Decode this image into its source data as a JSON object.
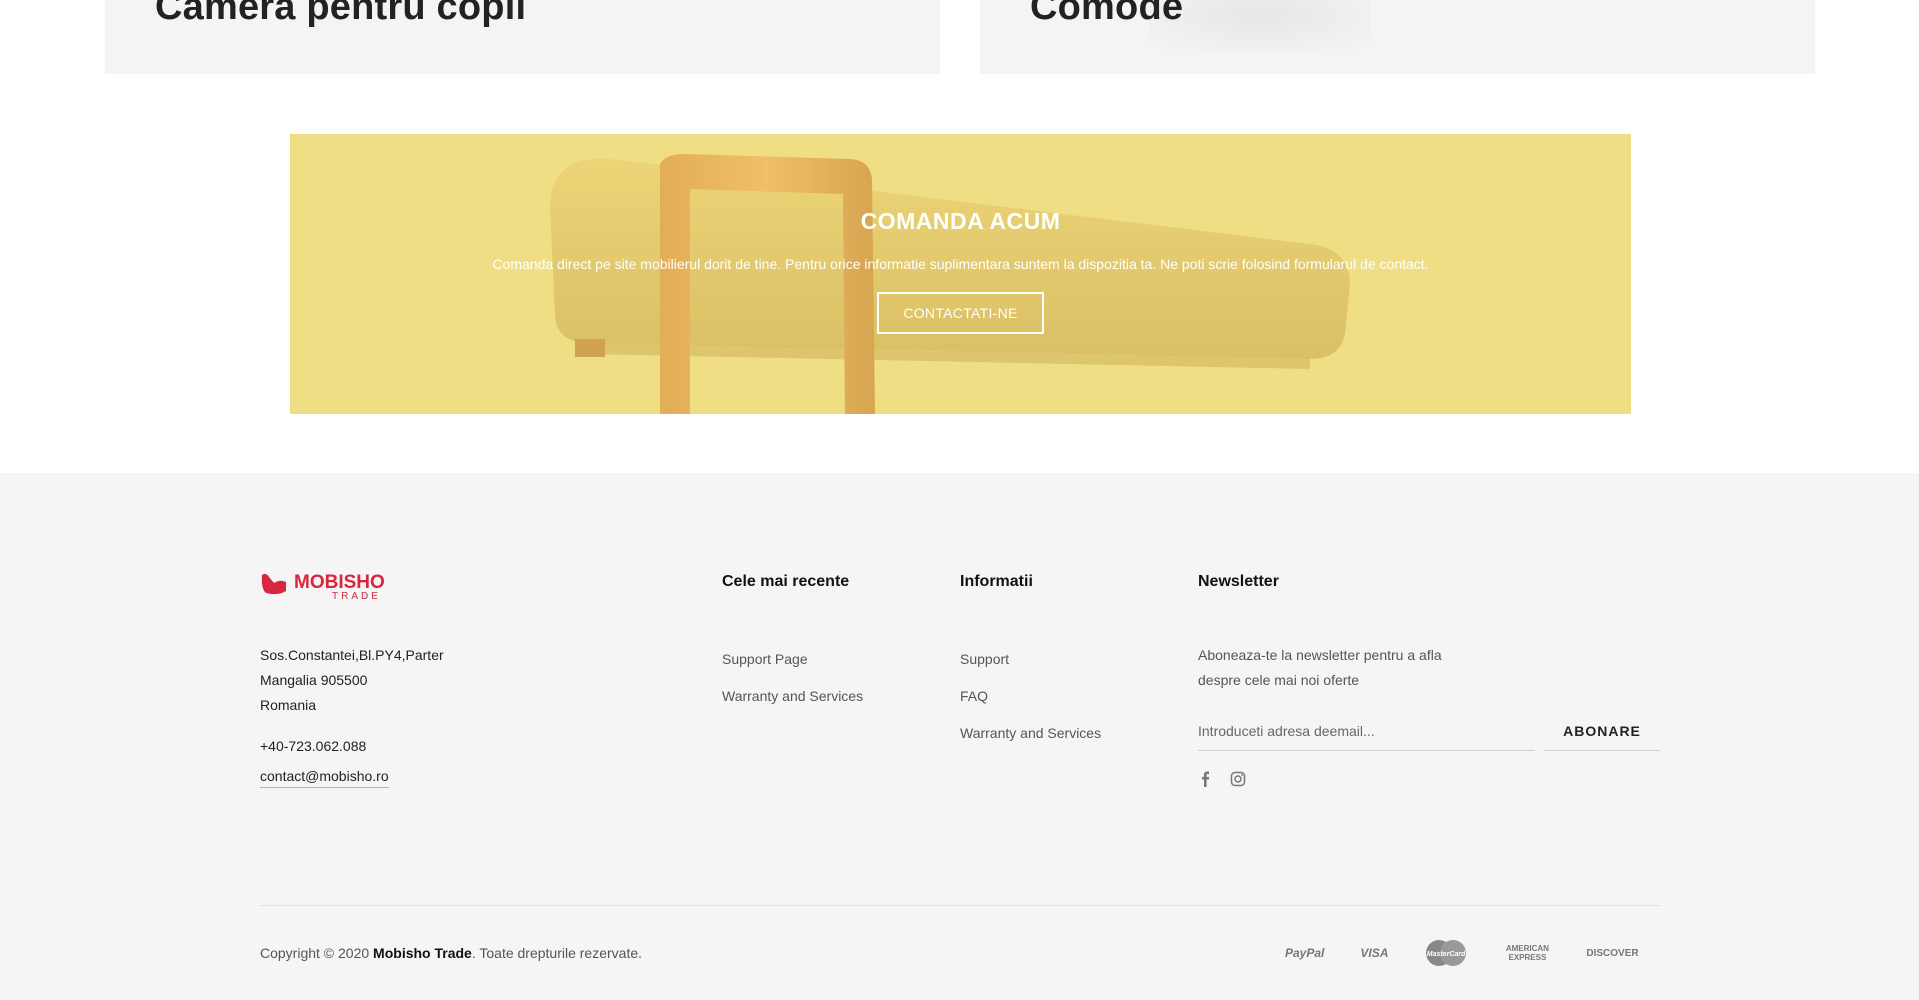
{
  "categories": [
    {
      "title": "Cameră pentru copii"
    },
    {
      "title": "Comode"
    }
  ],
  "banner": {
    "heading": "COMANDA ACUM",
    "text": "Comanda direct pe site mobilierul dorit de tine. Pentru orice informatie suplimentara suntem la dispozitia ta. Ne poti scrie folosind formularul de contact.",
    "button_label": "CONTACTATI-NE"
  },
  "footer": {
    "logo": {
      "name": "MOBISHO",
      "sub": "TRADE"
    },
    "address": [
      "Sos.Constantei,Bl.PY4,Parter",
      "Mangalia 905500",
      "Romania"
    ],
    "phone": "+40-723.062.088",
    "email": "contact@mobisho.ro",
    "recent": {
      "title": "Cele mai recente",
      "items": [
        "Support Page",
        "Warranty and Services"
      ]
    },
    "info": {
      "title": "Informatii",
      "items": [
        "Support",
        "FAQ",
        "Warranty and Services"
      ]
    },
    "newsletter": {
      "title": "Newsletter",
      "text": "Aboneaza-te la newsletter pentru a afla despre cele mai noi oferte",
      "placeholder": "Introduceti adresa deemail...",
      "button_label": "ABONARE"
    },
    "socials": [
      "facebook-icon",
      "instagram-icon"
    ],
    "copyright": {
      "prefix": "Copyright © 2020 ",
      "brand": "Mobisho Trade",
      "suffix": ". Toate drepturile rezervate."
    },
    "payments": [
      "PayPal",
      "VISA",
      "MasterCard",
      "AMERICAN EXPRESS",
      "DISCOVER"
    ]
  },
  "colors": {
    "banner": "#efdf86",
    "logo_red": "#d7263d",
    "footer_bg": "#f5f5f5"
  }
}
